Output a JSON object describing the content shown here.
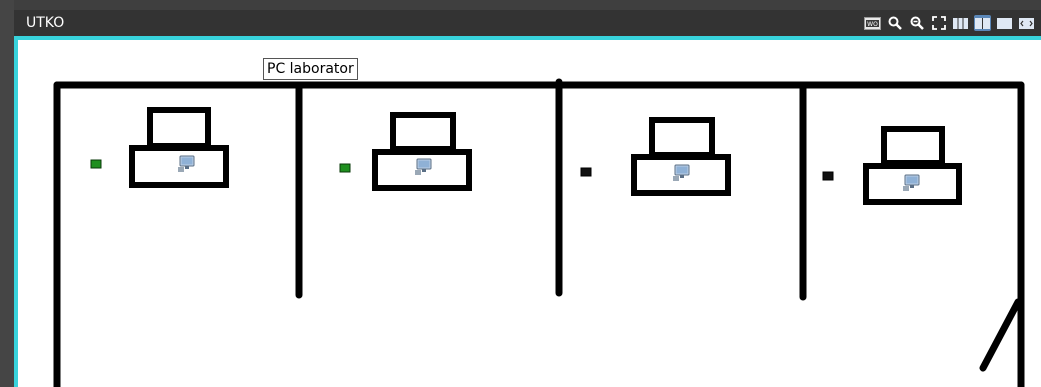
{
  "window": {
    "title": "UTKO"
  },
  "toolbar": {
    "icons": [
      "wo-icon",
      "zoom-in-icon",
      "zoom-out-icon",
      "fit-screen-icon",
      "layout-three-columns-icon",
      "layout-two-columns-icon",
      "layout-single-icon",
      "fullscreen-icon"
    ],
    "active": "layout-two-columns-icon"
  },
  "map": {
    "room_label": "PC laborator",
    "workstations": [
      {
        "status": "online",
        "status_color": "#1f8f1f"
      },
      {
        "status": "online",
        "status_color": "#1f8f1f"
      },
      {
        "status": "offline",
        "status_color": "#111111"
      },
      {
        "status": "offline",
        "status_color": "#111111"
      }
    ]
  },
  "colors": {
    "accent": "#38d3dc",
    "titlebar": "#333333",
    "wall": "#000000"
  }
}
